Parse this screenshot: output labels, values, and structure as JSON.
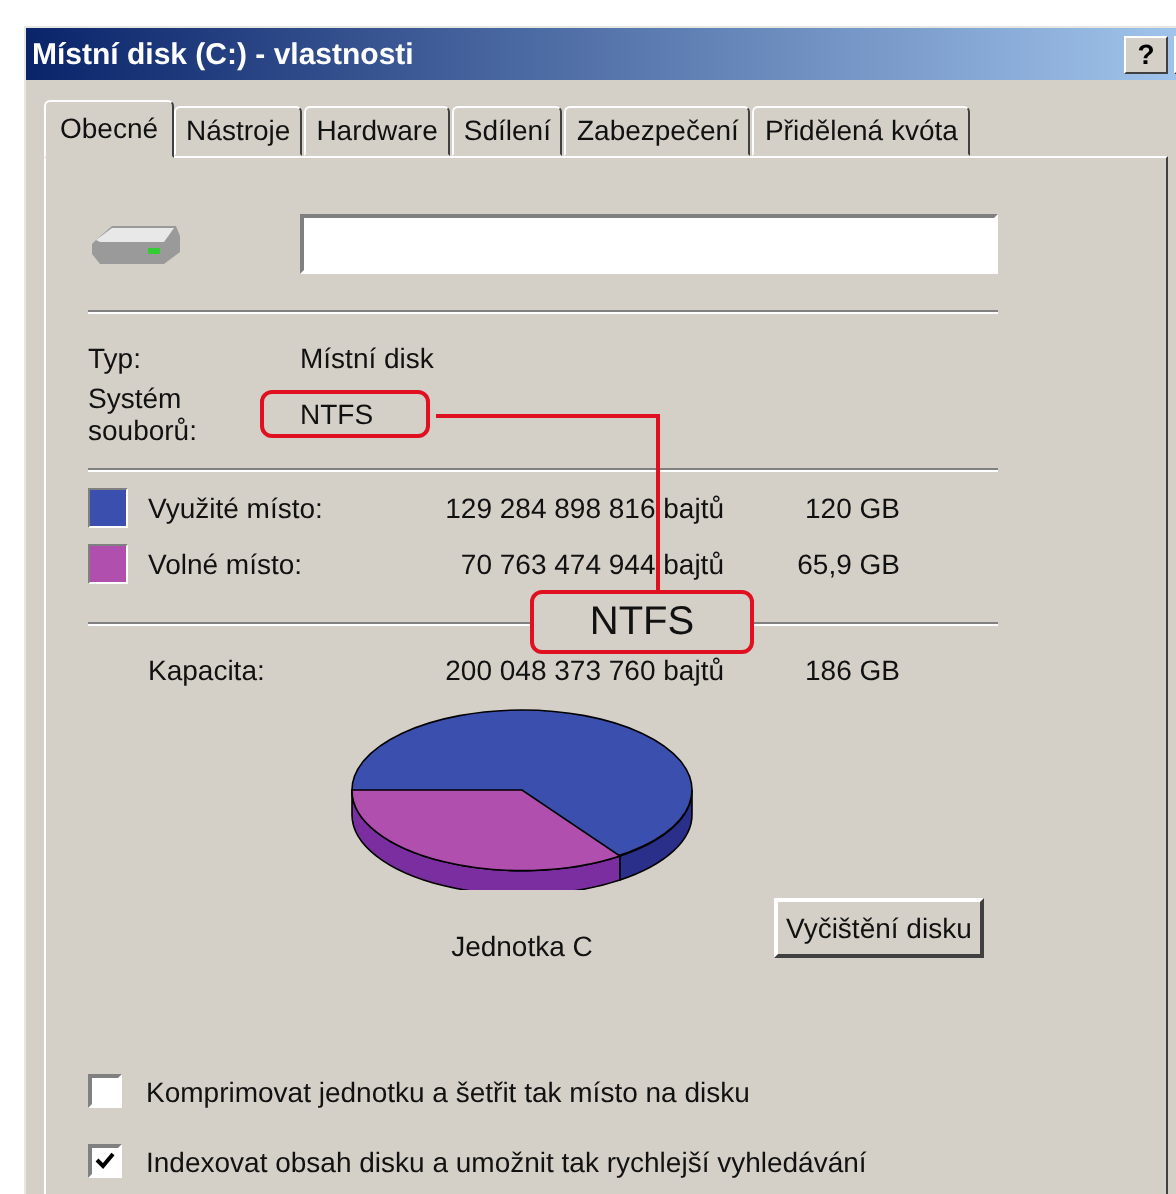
{
  "window": {
    "title": "Místní disk (C:) - vlastnosti",
    "help_button": "?"
  },
  "tabs": [
    {
      "label": "Obecné",
      "selected": true
    },
    {
      "label": "Nástroje",
      "selected": false
    },
    {
      "label": "Hardware",
      "selected": false
    },
    {
      "label": "Sdílení",
      "selected": false
    },
    {
      "label": "Zabezpečení",
      "selected": false
    },
    {
      "label": "Přidělená kvóta",
      "selected": false
    }
  ],
  "general": {
    "type": {
      "label": "Typ:",
      "value": "Místní disk"
    },
    "file_system": {
      "label": "Systém souborů:",
      "value": "NTFS",
      "highlighted": true
    },
    "space": [
      {
        "label": "Využité místo:",
        "bytes": "129 284 898 816 bajtů",
        "size": "120 GB",
        "color": "#3a4fae"
      },
      {
        "label": "Volné místo:",
        "bytes": "70 763 474 944 bajtů",
        "size": "65,9 GB",
        "color": "#b04fae"
      }
    ],
    "capacity": {
      "label": "Kapacita:",
      "bytes": "200 048 373 760 bajtů",
      "size": "186 GB"
    },
    "drive_label": "Jednotka C",
    "cleanup_button": "Vyčištění disku",
    "options": [
      {
        "label": "Komprimovat jednotku a šetřit tak místo na disku",
        "checked": false
      },
      {
        "label": "Indexovat obsah disku a umožnit tak rychlejší vyhledávání",
        "checked": true
      }
    ]
  },
  "callout": {
    "text": "NTFS"
  }
}
